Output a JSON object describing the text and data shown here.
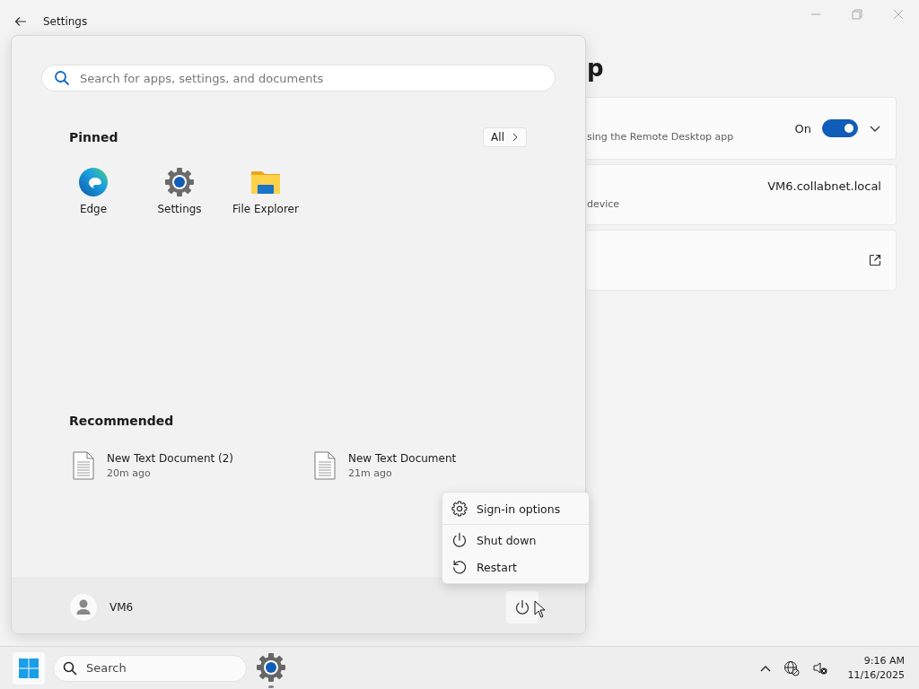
{
  "window": {
    "title": "Settings",
    "heading": "p"
  },
  "settings_cards": [
    {
      "kind": "toggle",
      "description": "sing the Remote Desktop app",
      "state_label": "On",
      "on": true,
      "expanded": false
    },
    {
      "kind": "value",
      "description": "device",
      "value": "VM6.collabnet.local"
    },
    {
      "kind": "link"
    }
  ],
  "start_menu": {
    "search": {
      "placeholder": "Search for apps, settings, and documents"
    },
    "pinned_title": "Pinned",
    "all_button": "All",
    "pinned": [
      {
        "label": "Edge",
        "kind": "edge"
      },
      {
        "label": "Settings",
        "kind": "settings"
      },
      {
        "label": "File Explorer",
        "kind": "folder"
      }
    ],
    "recommended_title": "Recommended",
    "recommended": [
      {
        "name": "New Text Document (2)",
        "time": "20m ago"
      },
      {
        "name": "New Text Document",
        "time": "21m ago"
      }
    ],
    "user": "VM6"
  },
  "power_menu": [
    {
      "label": "Sign-in options",
      "kind": "settings"
    },
    {
      "label": "Shut down",
      "kind": "power"
    },
    {
      "label": "Restart",
      "kind": "restart"
    }
  ],
  "taskbar": {
    "search_placeholder": "Search",
    "time": "9:16 AM",
    "date": "11/16/2025"
  }
}
